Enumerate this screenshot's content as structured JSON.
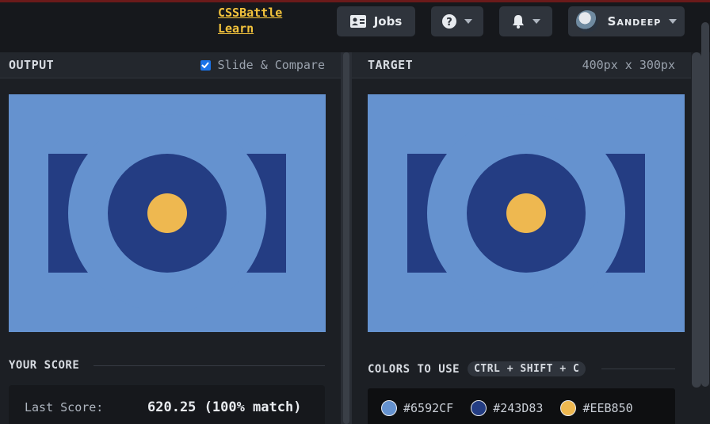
{
  "nav": {
    "links": [
      "CSSBattle",
      "Learn"
    ],
    "jobs_label": "Jobs",
    "user_name": "Sandeep"
  },
  "output": {
    "title": "OUTPUT",
    "slide_compare_label": "Slide & Compare",
    "slide_compare_checked": true
  },
  "target": {
    "title": "TARGET",
    "dimensions": "400px x 300px"
  },
  "score": {
    "title": "YOUR SCORE",
    "last_score_label": "Last Score:",
    "last_score_value": "620.25 (100% match)"
  },
  "colors": {
    "title": "COLORS TO USE",
    "shortcut": "CTRL + SHIFT + C",
    "list": [
      {
        "hex": "#6592CF"
      },
      {
        "hex": "#243D83"
      },
      {
        "hex": "#EEB850"
      }
    ]
  },
  "icons": {
    "jobs": "id-card-icon",
    "help": "question-circle-icon",
    "notifications": "bell-icon",
    "dropdown": "chevron-down-icon",
    "checkbox": "checkmark-icon"
  }
}
